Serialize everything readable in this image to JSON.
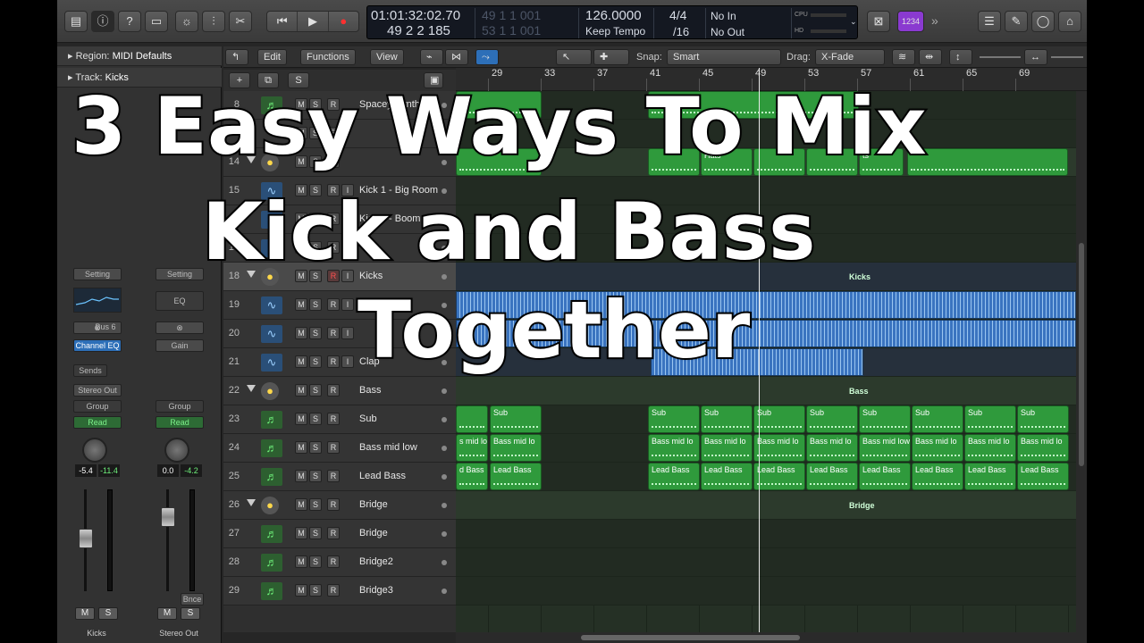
{
  "control_bar": {
    "lcd": {
      "smpte": "01:01:32:02.70",
      "bars": "49  2  2  185",
      "dim_top": "49   1   1   001",
      "dim_bottom": "53   1   1   001",
      "tempo": "126.0000",
      "tempo_mode": "Keep Tempo",
      "sig": "4/4",
      "division": "/16",
      "midi_in": "No In",
      "midi_out": "No Out",
      "cpu": "CPU",
      "hd": "HD"
    },
    "count_in": "1234"
  },
  "global_bar": {
    "edit": "Edit",
    "functions": "Functions",
    "view": "View",
    "snap_label": "Snap:",
    "snap_value": "Smart",
    "drag_label": "Drag:",
    "drag_value": "X-Fade"
  },
  "inspector": {
    "region_label": "Region:",
    "region_value": "MIDI Defaults",
    "track_label": "Track:",
    "track_value": "Kicks",
    "strip1": {
      "setting": "Setting",
      "bus": "Bus 6",
      "channel_eq": "Channel EQ",
      "sends": "Sends",
      "output": "Stereo Out",
      "group": "Group",
      "auto": "Read",
      "vol": "-5.4",
      "peak": "-11.4",
      "name": "Kicks"
    },
    "strip2": {
      "setting": "Setting",
      "eq": "EQ",
      "gain": "Gain",
      "group": "Group",
      "auto": "Read",
      "vol": "0.0",
      "peak": "-4.2",
      "bnce": "Bnce",
      "name": "Stereo Out"
    },
    "m": "M",
    "s": "S"
  },
  "tracks": [
    {
      "n": "8",
      "name": "Spacey Synth"
    },
    {
      "n": "",
      "name": ""
    },
    {
      "n": "14",
      "name": ""
    },
    {
      "n": "15",
      "name": "Kick 1 - Big Room"
    },
    {
      "n": "16",
      "name": "Kick 2 - Boom"
    },
    {
      "n": "17",
      "name": ""
    },
    {
      "n": "18",
      "name": "Kicks"
    },
    {
      "n": "19",
      "name": ""
    },
    {
      "n": "20",
      "name": ""
    },
    {
      "n": "21",
      "name": "Clap"
    },
    {
      "n": "22",
      "name": "Bass"
    },
    {
      "n": "23",
      "name": "Sub"
    },
    {
      "n": "24",
      "name": "Bass mid low"
    },
    {
      "n": "25",
      "name": "Lead Bass"
    },
    {
      "n": "26",
      "name": "Bridge"
    },
    {
      "n": "27",
      "name": "Bridge"
    },
    {
      "n": "28",
      "name": "Bridge2"
    },
    {
      "n": "29",
      "name": "Bridge3"
    }
  ],
  "ruler": [
    "29",
    "33",
    "37",
    "41",
    "45",
    "49",
    "53",
    "57",
    "61",
    "65",
    "69"
  ],
  "regions": {
    "hats": "Hats",
    "ts": "ts",
    "kicks": "Kicks",
    "bass": "Bass",
    "bridge": "Bridge",
    "sub": "Sub",
    "bass_mid_lo": "Bass mid lo",
    "bass_mid_low": "Bass mid low",
    "lead_bass": "Lead Bass",
    "cut_bass_mid_lo": "s mid lo",
    "cut_lead_bass": "d Bass"
  },
  "overlay": {
    "line1": "3 Easy Ways To Mix",
    "line2": "Kick and Bass",
    "line3": "Together"
  }
}
